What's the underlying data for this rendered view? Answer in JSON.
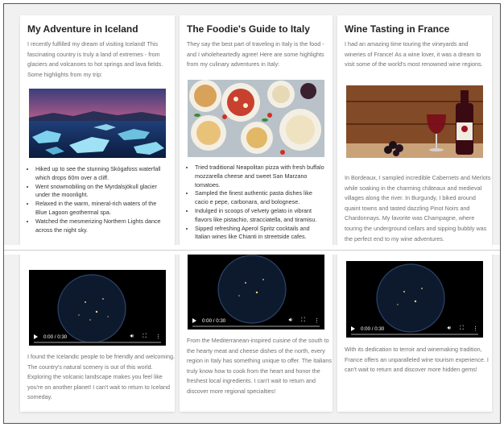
{
  "cards": [
    {
      "title": "My Adventure in Iceland",
      "intro": "I recently fulfilled my dream of visiting Iceland! This fascinating country is truly a land of extremes - from glaciers and volcanoes to hot springs and lava fields. Some highlights from my trip:",
      "image_icon": "glacier-lagoon-photo",
      "bullets": [
        "Hiked up to see the stunning Skógafoss waterfall which drops 60m over a cliff.",
        "Went snowmobiling on the Myrdalsjökull glacier under the moonlight.",
        "Relaxed in the warm, mineral-rich waters of the Blue Lagoon geothermal spa.",
        "Watched the mesmerizing Northern Lights dance across the night sky."
      ],
      "video": {
        "time": "0:00 / 0:30"
      },
      "body": "I found the Icelandic people to be friendly and welcoming. The country's natural scenery is out of this world. Exploring the volcanic landscape makes you feel like you're on another planet! I can't wait to return to Iceland someday."
    },
    {
      "title": "The Foodie's Guide to Italy",
      "intro": "They say the best part of traveling in Italy is the food - and I wholeheartedly agree! Here are some highlights from my culinary adventures in Italy:",
      "image_icon": "italian-food-photo",
      "bullets": [
        "Tried traditional Neapolitan pizza with fresh buffalo mozzarella cheese and sweet San Marzano tomatoes.",
        "Sampled the finest authentic pasta dishes like cacio e pepe, carbonara, and bolognese.",
        "Indulged in scoops of velvety gelato in vibrant flavors like pistachio, stracciatella, and tiramisu.",
        "Sipped refreshing Aperol Spritz cocktails and Italian wines like Chianti in streetside cafes."
      ],
      "video": {
        "time": "0:00 / 0:30"
      },
      "body": "From the Mediterranean-inspired cuisine of the south to the hearty meat and cheese dishes of the north, every region in Italy has something unique to offer. The Italians truly know how to cook from the heart and honor the freshest local ingredients. I can't wait to return and discover more regional specialties!"
    },
    {
      "title": "Wine Tasting in France",
      "intro": "I had an amazing time touring the vineyards and wineries of France! As a wine lover, it was a dream to visit some of the world's most renowned wine regions.",
      "image_icon": "wine-bottle-glass-photo",
      "body_top": "In Bordeaux, I sampled incredible Cabernets and Merlots while soaking in the charming châteaux and medieval villages along the river. In Burgundy, I biked around quaint towns and tasted dazzling Pinot Noirs and Chardonnays. My favorite was Champagne, where touring the underground cellars and sipping bubbly was the perfect end to my wine adventures.",
      "video": {
        "time": "0:00 / 0:30"
      },
      "body": "With its dedication to terroir and winemaking tradition, France offers an unparalleled wine tourism experience. I can't wait to return and discover more hidden gems!"
    }
  ]
}
